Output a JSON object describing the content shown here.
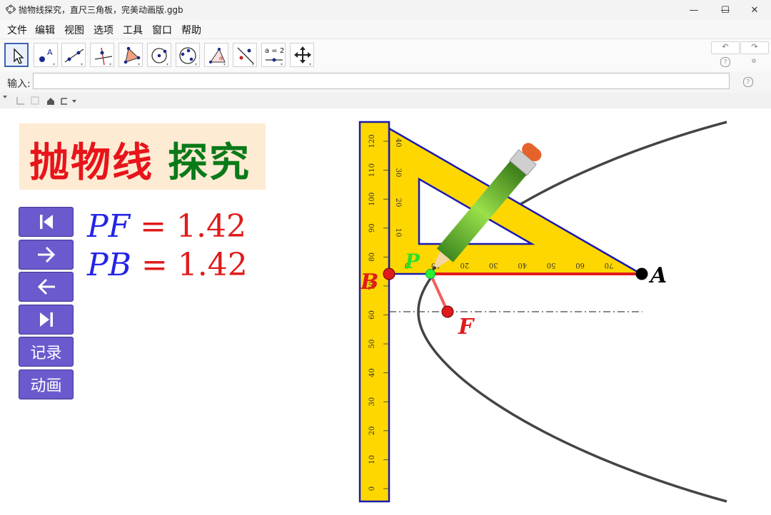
{
  "window": {
    "title": "抛物线探究，直尺三角板，完美动画版.ggb",
    "minimize_glyph": "—",
    "maximize_glyph": "☐",
    "close_glyph": "✕"
  },
  "menu": [
    "文件",
    "编辑",
    "视图",
    "选项",
    "工具",
    "窗口",
    "帮助"
  ],
  "toolbar": {
    "tools": [
      "move-tool",
      "point-tool",
      "line-tool",
      "perpendicular-tool",
      "polygon-tool",
      "circle-tool",
      "conic-tool",
      "angle-tool",
      "reflect-tool",
      "slider-tool",
      "move-view-tool"
    ],
    "slider_label": "a = 2",
    "undo_glyph": "↶",
    "redo_glyph": "↷"
  },
  "input_bar": {
    "label": "输入:",
    "value": ""
  },
  "graphics": {
    "banner_part1": "抛物线",
    "banner_part2": "探究",
    "banner_color1": "#e8141b",
    "banner_color2": "#0a7a18",
    "buttons": {
      "record": "记录",
      "animate": "动画"
    },
    "eq1": {
      "lhs": "PF",
      "eq": " = ",
      "val": "1.42"
    },
    "eq2": {
      "lhs": "PB",
      "eq": " = ",
      "val": "1.42"
    },
    "points": {
      "A": "A",
      "B": "B",
      "F": "F",
      "P": "P"
    },
    "ruler_ticks": [
      "0",
      "10",
      "20",
      "30",
      "40",
      "50",
      "60",
      "70",
      "80",
      "90",
      "100",
      "110",
      "120"
    ],
    "triangle_ticks_h": [
      "0",
      "10",
      "20",
      "30",
      "40",
      "50",
      "60",
      "70"
    ],
    "triangle_ticks_v": [
      "10",
      "20",
      "30",
      "40"
    ],
    "accent_color": "#6a5acd"
  }
}
